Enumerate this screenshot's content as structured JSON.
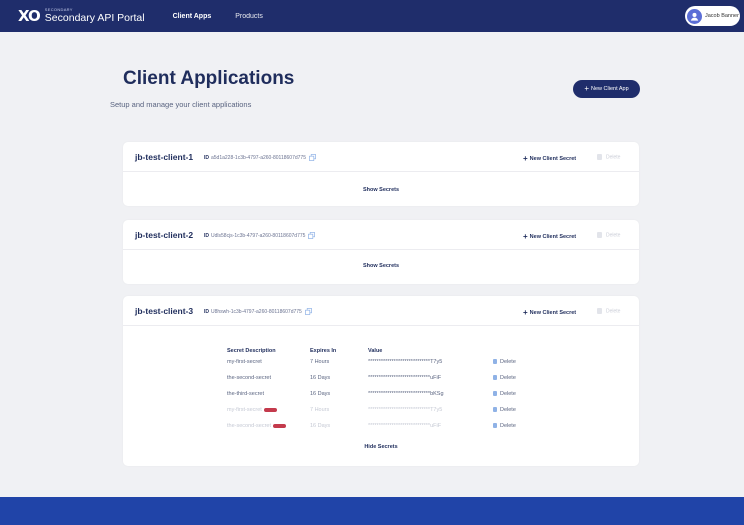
{
  "header": {
    "logo_mark": "XO",
    "logo_small": "SECONDARY",
    "logo_title": "Secondary API Portal",
    "nav": [
      {
        "label": "Client Apps"
      },
      {
        "label": "Products"
      }
    ],
    "user_name": "Jacob Banner"
  },
  "page": {
    "title": "Client Applications",
    "subtitle": "Setup and manage your client applications",
    "new_app_label": "New Client App"
  },
  "clients": [
    {
      "name": "jb-test-client-1",
      "id_label": "ID",
      "id": "a5d1a228-1c3b-4797-a260-80118607d775",
      "new_secret_label": "New Client Secret",
      "delete_label": "Delete",
      "toggle_label": "Show Secrets"
    },
    {
      "name": "jb-test-client-2",
      "id_label": "ID",
      "id": "Udls58cjs-1c3b-4797-a260-80118607d775",
      "new_secret_label": "New Client Secret",
      "delete_label": "Delete",
      "toggle_label": "Show Secrets"
    },
    {
      "name": "jb-test-client-3",
      "id_label": "ID",
      "id": "U8hswh-1c3b-4797-a260-80118607d775",
      "new_secret_label": "New Client Secret",
      "delete_label": "Delete",
      "toggle_label": "Hide Secrets",
      "secrets": {
        "columns": [
          "Secret Description",
          "Expires In",
          "Value"
        ],
        "delete_label": "Delete",
        "rows": [
          {
            "description": "my-first-secret",
            "expires": "7 Hours",
            "value": "*****************************T7y5",
            "expired": false
          },
          {
            "description": "the-second-secret",
            "expires": "16 Days",
            "value": "*****************************uFiF",
            "expired": false
          },
          {
            "description": "the-third-secret",
            "expires": "16 Days",
            "value": "*****************************bKSg",
            "expired": false
          },
          {
            "description": "my-first-secret",
            "expires": "7 Hours",
            "value": "*****************************T7y5",
            "expired": true
          },
          {
            "description": "the-second-secret",
            "expires": "16 Days",
            "value": "*****************************uFiF",
            "expired": true
          }
        ]
      }
    }
  ],
  "colors": {
    "navy": "#1f2d6b",
    "footer_blue": "#2044a8",
    "badge_red": "#c43a4c",
    "background": "#f0f1f4"
  }
}
